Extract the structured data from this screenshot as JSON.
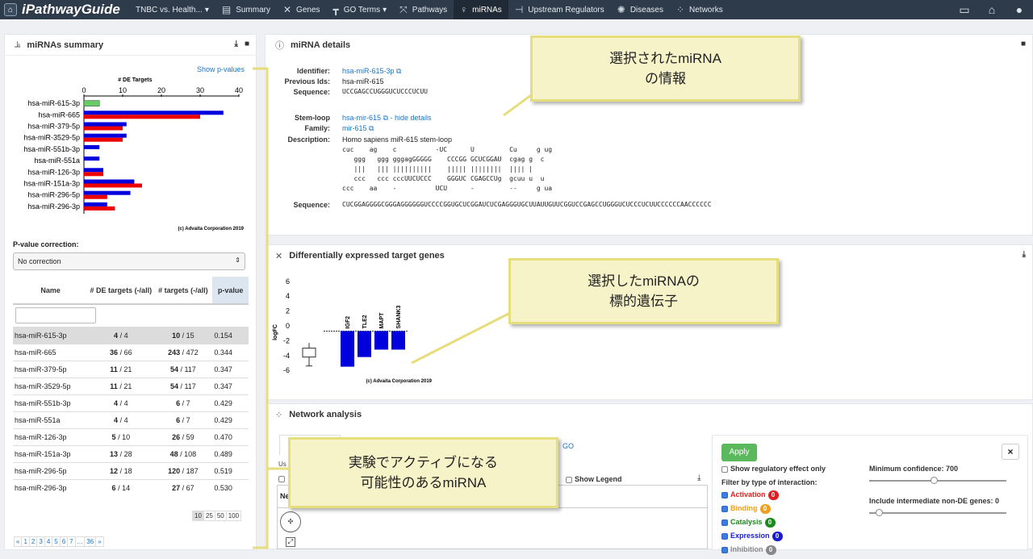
{
  "nav": {
    "brand": "iPathwayGuide",
    "analysis": "TNBC vs. Health...",
    "items": [
      "Summary",
      "Genes",
      "GO Terms",
      "Pathways",
      "miRNAs",
      "Upstream Regulators",
      "Diseases",
      "Networks"
    ],
    "active": "miRNAs"
  },
  "summary": {
    "title": "miRNAs summary",
    "show_pvalues": "Show p-values",
    "chart_title": "# DE Targets",
    "copyright": "(c) Advaita Corporation 2019",
    "correction_label": "P-value correction:",
    "correction_value": "No correction",
    "columns": [
      "Name",
      "# DE targets (-/all)",
      "# targets (-/all)",
      "p-value"
    ],
    "rows": [
      {
        "name": "hsa-miR-615-3p",
        "de": "4",
        "de_all": " / 4",
        "t": "10",
        "t_all": " / 15",
        "p": "0.154"
      },
      {
        "name": "hsa-miR-665",
        "de": "36",
        "de_all": " / 66",
        "t": "243",
        "t_all": " / 472",
        "p": "0.344"
      },
      {
        "name": "hsa-miR-379-5p",
        "de": "11",
        "de_all": " / 21",
        "t": "54",
        "t_all": " / 117",
        "p": "0.347"
      },
      {
        "name": "hsa-miR-3529-5p",
        "de": "11",
        "de_all": " / 21",
        "t": "54",
        "t_all": " / 117",
        "p": "0.347"
      },
      {
        "name": "hsa-miR-551b-3p",
        "de": "4",
        "de_all": " / 4",
        "t": "6",
        "t_all": " / 7",
        "p": "0.429"
      },
      {
        "name": "hsa-miR-551a",
        "de": "4",
        "de_all": " / 4",
        "t": "6",
        "t_all": " / 7",
        "p": "0.429"
      },
      {
        "name": "hsa-miR-126-3p",
        "de": "5",
        "de_all": " / 10",
        "t": "26",
        "t_all": " / 59",
        "p": "0.470"
      },
      {
        "name": "hsa-miR-151a-3p",
        "de": "13",
        "de_all": " / 28",
        "t": "48",
        "t_all": " / 108",
        "p": "0.489"
      },
      {
        "name": "hsa-miR-296-5p",
        "de": "12",
        "de_all": " / 18",
        "t": "120",
        "t_all": " / 187",
        "p": "0.519"
      },
      {
        "name": "hsa-miR-296-3p",
        "de": "6",
        "de_all": " / 14",
        "t": "27",
        "t_all": " / 67",
        "p": "0.530"
      }
    ],
    "page_sizes": [
      "10",
      "25",
      "50",
      "100"
    ],
    "pages": [
      "«",
      "1",
      "2",
      "3",
      "4",
      "5",
      "6",
      "7",
      "...",
      "36",
      "»"
    ]
  },
  "details": {
    "title": "miRNA details",
    "identifier_label": "Identifier:",
    "identifier": "hsa-miR-615-3p",
    "previous_label": "Previous Ids:",
    "previous": "hsa-miR-615",
    "sequence_label": "Sequence:",
    "sequence": "UCCGAGCCUGGGUCUCCCUCUU",
    "stemloop_label": "Stem-loop",
    "stemloop": "hsa-mir-615",
    "hide_details": "- hide details",
    "family_label": "Family:",
    "family": "mir-615",
    "description_label": "Description:",
    "description": "Homo sapiens miR-615 stem-loop",
    "structure": "cuc    ag    c          -UC      U         Cu     g ug\n   ggg   ggg gggagGGGGG    CCCGG GCUCGGAU  cgag g  c\n   |||   ||| ||||||||||    ||||| ||||||||  |||| |  \n   ccc   ccc cccUUCUCCC    GGGUC CGAGCCUg  gcuu u  u\nccc    aa    -          UCU      -         --     g ua",
    "sequence2_label": "Sequence:",
    "sequence2": "CUCGGAGGGGCGGGAGGGGGGUCCCCGGUGCUCGGAUCUCGAGGGUGCUUAUUGUUCGGUCCGAGCCUGGGUCUCCCUCUUCCCCCCAACCCCCC"
  },
  "targets": {
    "title": "Differentially expressed target genes",
    "ylabel": "logFC",
    "copyright": "(c) Advaita Corporation 2019"
  },
  "network": {
    "title": "Network analysis",
    "go_fragment": "GO",
    "use_fragment": "Us",
    "show_legend": "Show Legend",
    "ne_fragment": "Ne",
    "apply": "Apply",
    "close": "×",
    "show_reg_only": "Show regulatory effect only",
    "filter_label": "Filter by type of interaction:",
    "filters": [
      {
        "label": "Activation",
        "count": "0",
        "color": "#e02020"
      },
      {
        "label": "Binding",
        "count": "0",
        "color": "#f0a020"
      },
      {
        "label": "Catalysis",
        "count": "0",
        "color": "#1a8a1a"
      },
      {
        "label": "Expression",
        "count": "0",
        "color": "#1a1ad0"
      },
      {
        "label": "Inhibition",
        "count": "0",
        "color": "#888888"
      }
    ],
    "min_conf_label": "Minimum confidence: 700",
    "non_de_label": "Include intermediate non-DE genes: 0"
  },
  "callouts": {
    "details": "選択されたmiRNA\nの情報",
    "targets": "選択したmiRNAの\n標的遺伝子",
    "list": "実験でアクティブになる\n可能性のあるmiRNA"
  },
  "chart_data": [
    {
      "type": "bar",
      "title": "# DE Targets",
      "categories": [
        "hsa-miR-615-3p",
        "hsa-miR-665",
        "hsa-miR-379-5p",
        "hsa-miR-3529-5p",
        "hsa-miR-551b-3p",
        "hsa-miR-551a",
        "hsa-miR-126-3p",
        "hsa-miR-151a-3p",
        "hsa-miR-296-5p",
        "hsa-miR-296-3p"
      ],
      "series": [
        {
          "color": "#0000dd",
          "values": [
            0,
            36,
            11,
            11,
            4,
            4,
            5,
            13,
            12,
            6
          ]
        },
        {
          "color": "#ee0000",
          "values": [
            0,
            30,
            10,
            10,
            0,
            0,
            5,
            15,
            6,
            8
          ]
        },
        {
          "color": "#66cc66",
          "values": [
            4,
            0,
            0,
            0,
            0,
            0,
            0,
            0,
            0,
            0
          ]
        }
      ],
      "xticks": [
        "0",
        "10",
        "20",
        "30",
        "40"
      ],
      "xlim": [
        0,
        40
      ],
      "orientation": "horizontal"
    },
    {
      "type": "bar",
      "categories": [
        "IGF2",
        "TLE2",
        "MAPT",
        "SHANK3"
      ],
      "values": [
        -5.5,
        -4.2,
        -3.2,
        -3.2
      ],
      "ylabel": "logFC",
      "yticks": [
        "6",
        "4",
        "2",
        "0",
        "-2",
        "-4",
        "-6"
      ],
      "ylim": [
        -6,
        6
      ],
      "color": "#0000dd"
    }
  ]
}
